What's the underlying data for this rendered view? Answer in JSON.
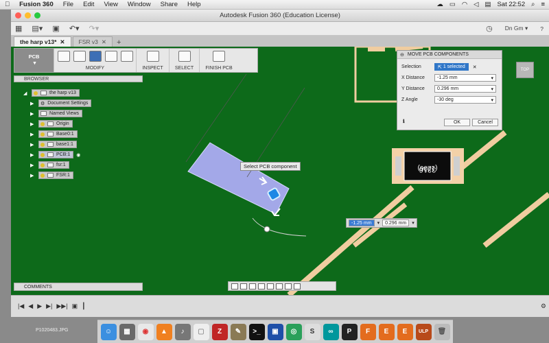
{
  "menubar": {
    "apple": "",
    "app": "Fusion 360",
    "items": [
      "File",
      "Edit",
      "View",
      "Window",
      "Share",
      "Help"
    ],
    "clock": "Sat 22:52"
  },
  "window": {
    "title": "Autodesk Fusion 360 (Education License)"
  },
  "qat": {
    "user": "Dn Gm ▾",
    "help": "?"
  },
  "tabs": [
    {
      "label": "the harp v13*"
    },
    {
      "label": "FSR v3"
    }
  ],
  "toolbar": {
    "mode": "PCB",
    "groups": [
      "MODIFY",
      "INSPECT",
      "SELECT",
      "FINISH PCB"
    ]
  },
  "browser": {
    "title": "BROWSER",
    "items": [
      {
        "label": "the harp v13"
      },
      {
        "label": "Document Settings"
      },
      {
        "label": "Named Views"
      },
      {
        "label": "Origin"
      },
      {
        "label": "Base0:1"
      },
      {
        "label": "base1:1"
      },
      {
        "label": "PCB:1"
      },
      {
        "label": "fsr:1"
      },
      {
        "label": "FSR:1"
      }
    ]
  },
  "comments": {
    "title": "COMMENTS"
  },
  "viewcube": {
    "label": "TOP"
  },
  "dialog": {
    "title": "MOVE PCB COMPONENTS",
    "selection_label": "Selection",
    "selection_value": "1 selected",
    "x_label": "X Distance",
    "x_value": "-1.25 mm",
    "y_label": "Y Distance",
    "y_value": "0.296 mm",
    "z_label": "Z Angle",
    "z_value": "-30 deg",
    "ok": "OK",
    "cancel": "Cancel"
  },
  "tooltip": "Select PCB component",
  "distance": {
    "x": "-1.25 mm",
    "y": "0.296 mm"
  },
  "component": {
    "line1": "3216",
    "line2": "(1206)"
  },
  "desktop_file": "P1020483.JPG"
}
